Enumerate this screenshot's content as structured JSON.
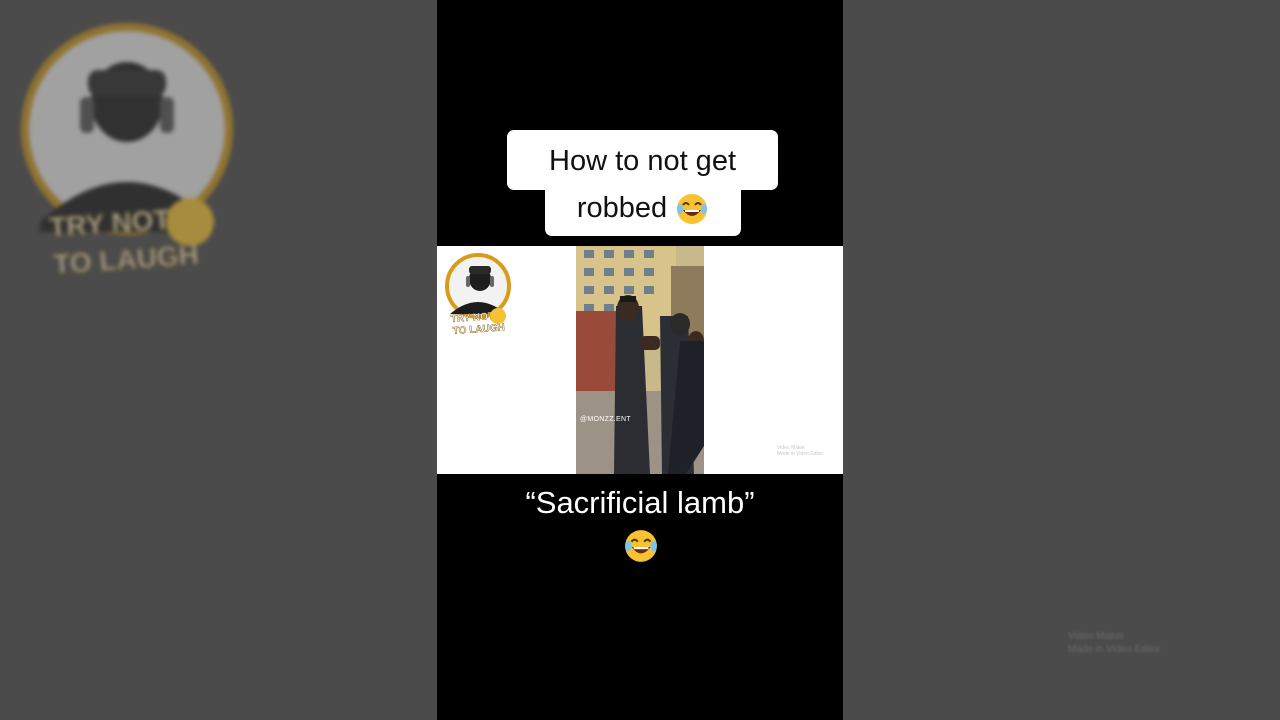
{
  "video": {
    "title_line1": "How to not get",
    "title_line2": "robbed",
    "caption": "“Sacrificial lamb”",
    "clip_handle": "@MONZZ.ENT",
    "side_watermark_line1": "Video Maker",
    "side_watermark_line2": "Made in Video Editor"
  },
  "channel_logo": {
    "text": "TRY NOT TO LAUGH",
    "ring_color": "#d99b1c"
  },
  "icons": [
    "laughing-emoji-icon"
  ],
  "colors": {
    "side_background": "#4b4b4b",
    "center_background": "#000000",
    "title_box": "#ffffff"
  }
}
